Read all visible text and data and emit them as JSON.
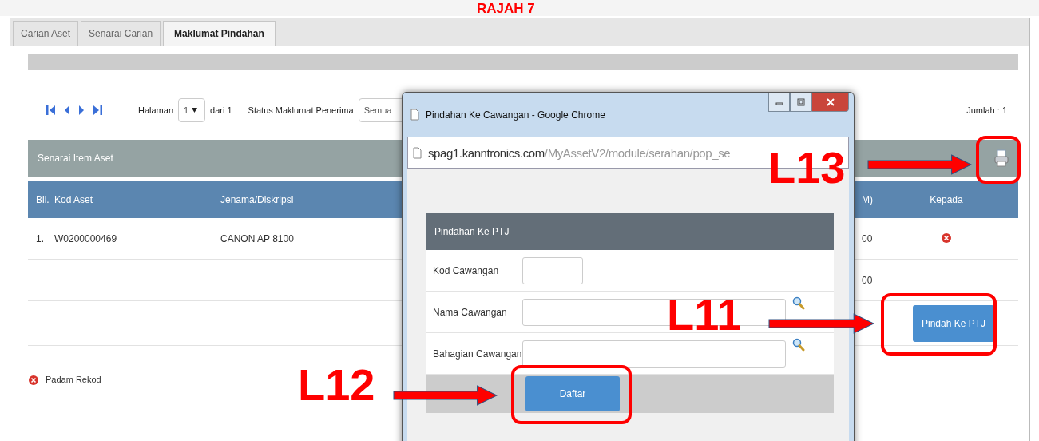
{
  "page_title": "RAJAH 7",
  "tabs": [
    {
      "label": "Carian Aset",
      "selected": false
    },
    {
      "label": "Senarai Carian",
      "selected": false
    },
    {
      "label": "Maklumat Pindahan",
      "selected": true
    }
  ],
  "pager": {
    "page_label": "Halaman",
    "page_value": "1",
    "of_label": "dari 1",
    "status_label": "Status Maklumat Penerima",
    "status_value": "Semua",
    "total": "Jumlah : 1"
  },
  "section": {
    "title": "Senarai Item Aset"
  },
  "table": {
    "columns": [
      "Bil.",
      "Kod Aset",
      "Jenama/Diskripsi",
      "M)",
      "Kepada"
    ],
    "rows": [
      {
        "bil": "1.",
        "kod": "W0200000469",
        "jenama": "CANON AP 8100",
        "column_4": "00",
        "deletable": true
      },
      {
        "column_4": "00",
        "deletable": false
      }
    ]
  },
  "transfer_button": "Pindah Ke PTJ",
  "legend": {
    "label": "Padam Rekod"
  },
  "popup": {
    "title": "Pindahan Ke Cawangan - Google Chrome",
    "url_host": "spag1.kanntronics.com",
    "url_path": "/MyAssetV2/module/serahan/pop_se",
    "form_title": "Pindahan Ke PTJ",
    "fields": [
      {
        "label": "Kod Cawangan",
        "kind": "short"
      },
      {
        "label": "Nama Cawangan",
        "kind": "lookup"
      },
      {
        "label": "Bahagian Cawangan",
        "kind": "lookup"
      }
    ],
    "submit": "Daftar"
  },
  "annotations": [
    {
      "label": "L13",
      "kind": "print"
    },
    {
      "label": "L11",
      "kind": "transfer"
    },
    {
      "label": "L12",
      "kind": "submit"
    }
  ]
}
